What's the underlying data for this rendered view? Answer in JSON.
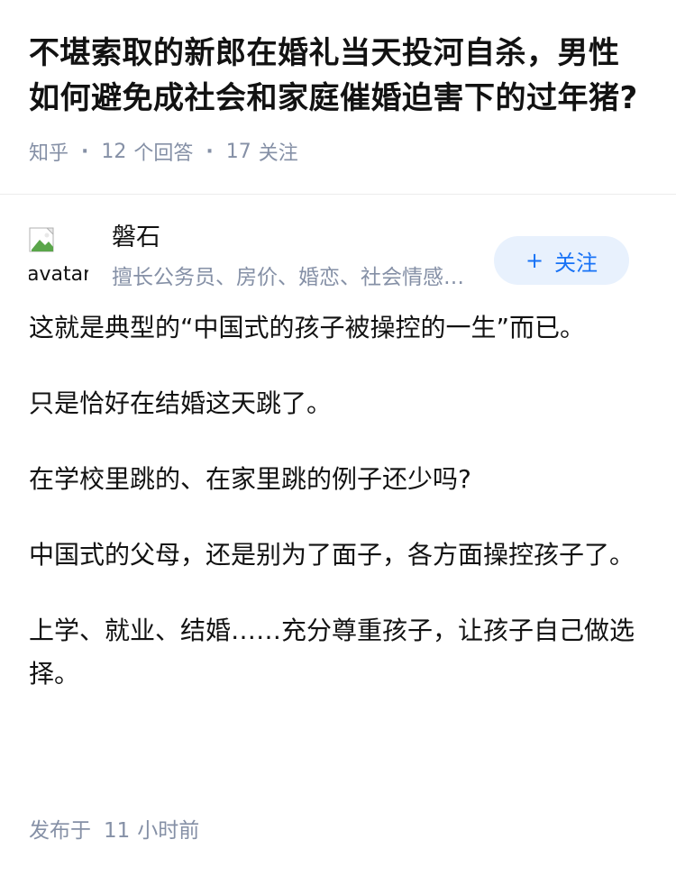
{
  "question": {
    "title": "不堪索取的新郎在婚礼当天投河自杀，男性如何避免成社会和家庭催婚迫害下的过年猪?",
    "source": "知乎",
    "answer_count": "12",
    "answer_label": "个回答",
    "follow_count": "17",
    "follow_label": "关注"
  },
  "answer": {
    "author": {
      "avatar_alt": "avatar",
      "name": "磐石",
      "description": "擅长公务员、房价、婚恋、社会情感、心理学"
    },
    "follow_button": {
      "plus": "+",
      "label": "关注"
    },
    "paragraphs": [
      "这就是典型的“中国式的孩子被操控的一生”而已。",
      "只是恰好在结婚这天跳了。",
      "在学校里跳的、在家里跳的例子还少吗?",
      "中国式的父母，还是别为了面子，各方面操控孩子了。",
      "上学、就业、结婚……充分尊重孩子，让孩子自己做选择。"
    ],
    "published_prefix": "发布于",
    "published_num": "11",
    "published_unit": "小时前"
  },
  "colors": {
    "meta": "#8590a6",
    "accent": "#1772f6",
    "follow_bg": "#e8f1fd",
    "text": "#121212"
  }
}
